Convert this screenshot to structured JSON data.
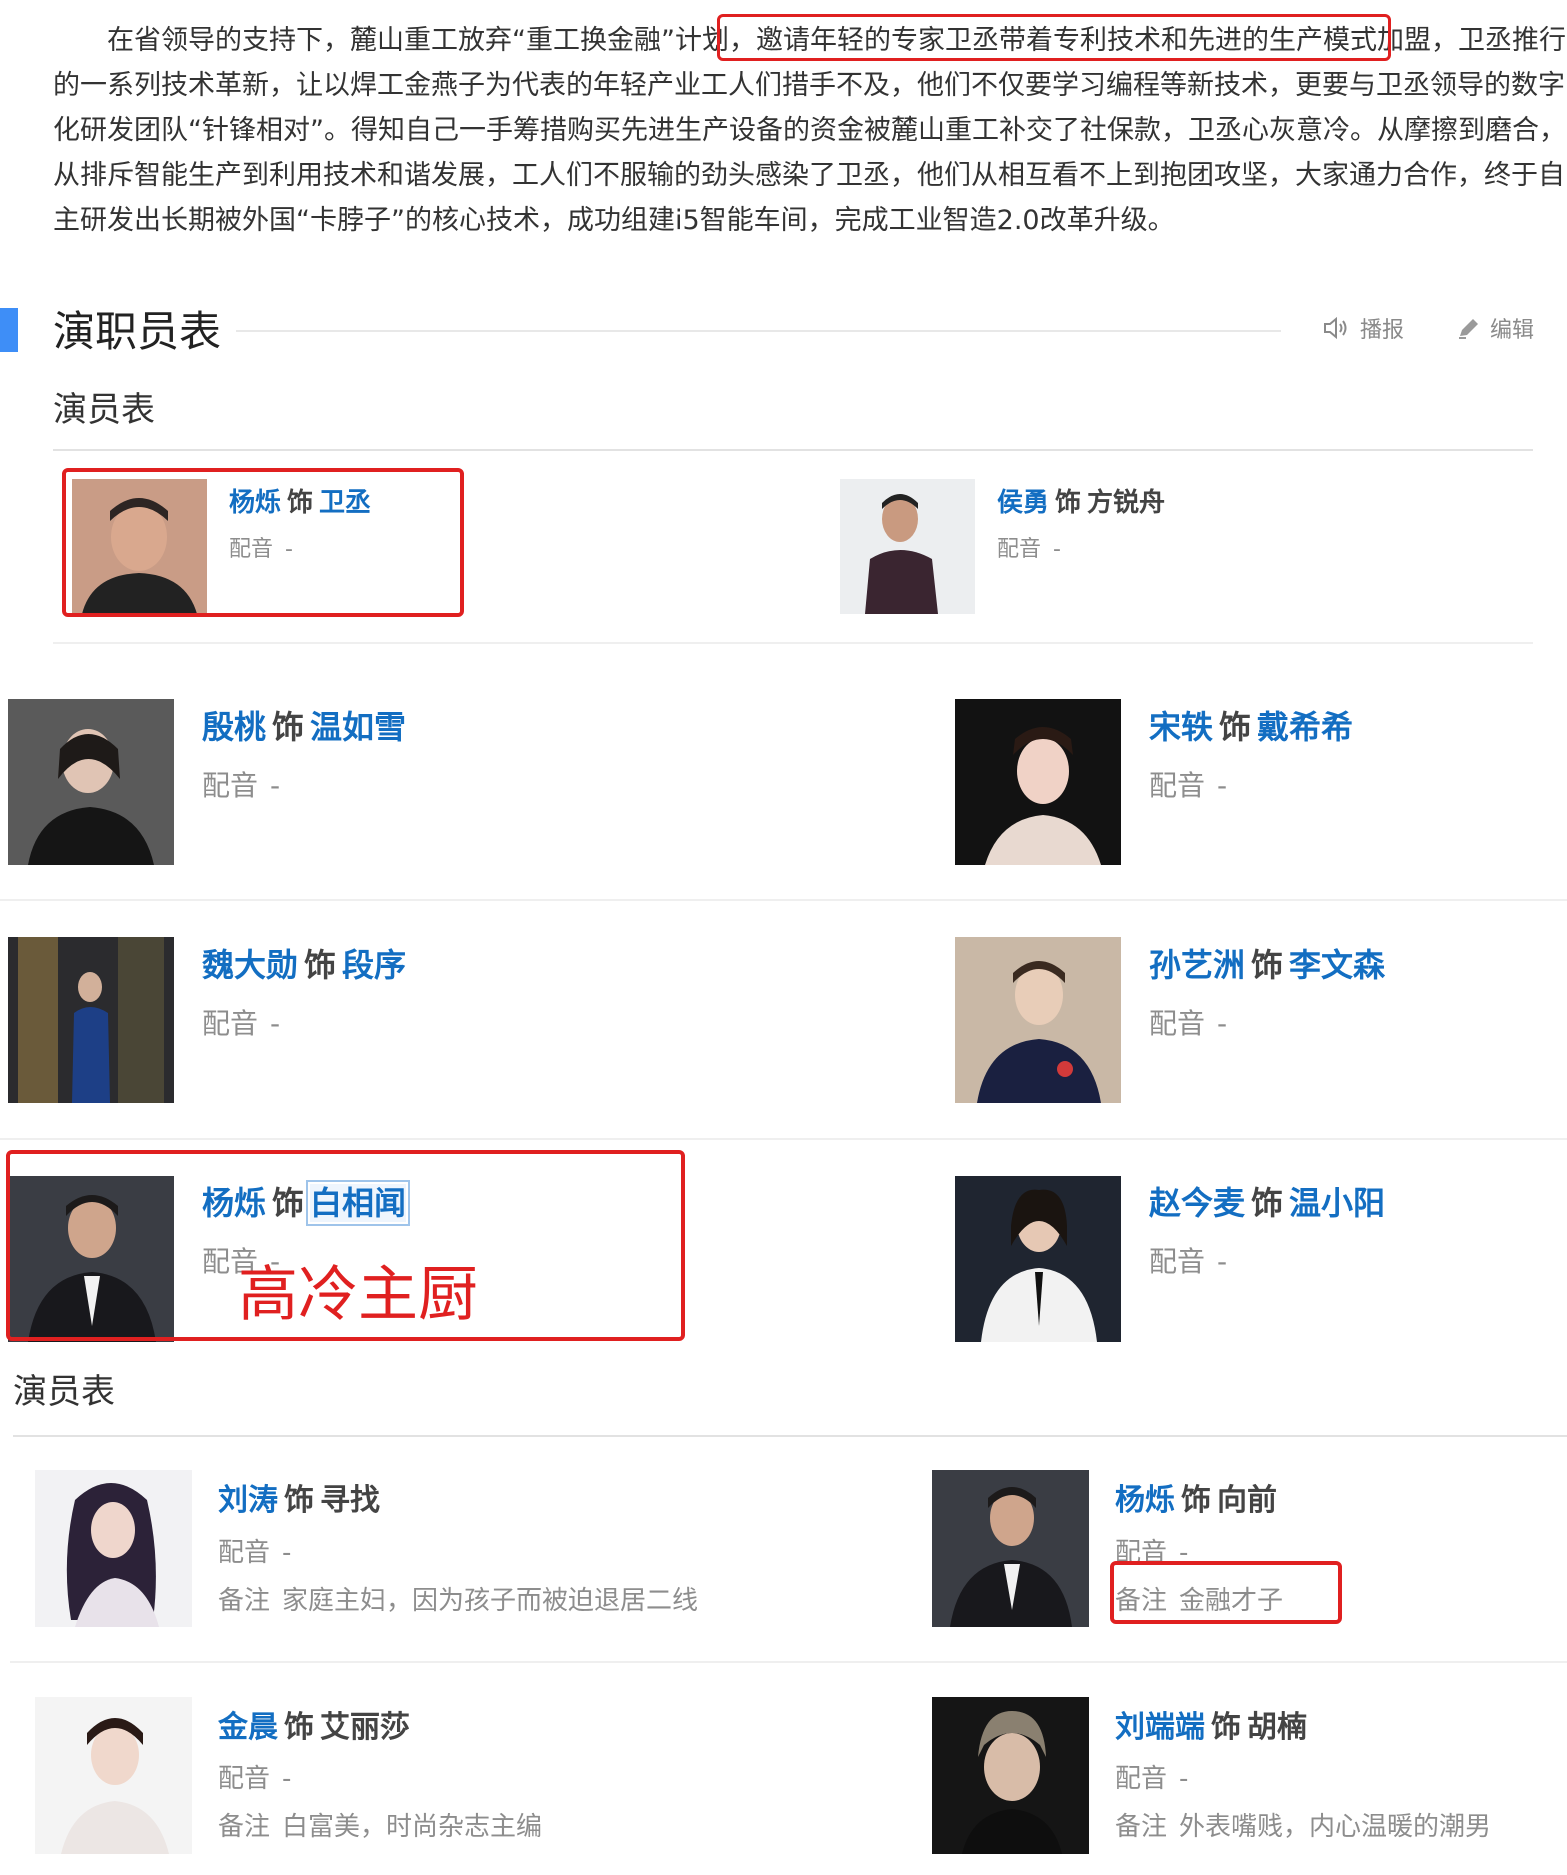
{
  "intro": {
    "lines": [
      "　　在省领导的支持下，麓山重工放弃“重工换金融”计划，邀请年轻的专家卫丞带着专利技术和先进的生产模式加盟，卫丞推行",
      "的一系列技术革新，让以焊工金燕子为代表的年轻产业工人们措手不及，他们不仅要学习编程等新技术，更要与卫丞领导的数字",
      "化研发团队“针锋相对”。得知自己一手筹措购买先进生产设备的资金被麓山重工补交了社保款，卫丞心灰意冷。从摩擦到磨合，",
      "从排斥智能生产到利用技术和谐发展，工人们不服输的劲头感染了卫丞，他们从相互看不上到抱团攻坚，大家通力合作，终于自",
      "主研发出长期被外国“卡脖子”的核心技术，成功组建i5智能车间，完成工业智造2.0改革升级。"
    ]
  },
  "section": {
    "title": "演职员表",
    "broadcast_label": "播报",
    "edit_label": "编辑",
    "broadcast_icon": "speaker-icon",
    "edit_icon": "pencil-icon"
  },
  "cast1": {
    "subtitle": "演员表",
    "members": [
      {
        "actor": "杨烁",
        "as": "饰",
        "role": "卫丞",
        "voice_label": "配音",
        "voice_value": "-"
      },
      {
        "actor": "侯勇",
        "as": "饰",
        "role": "方锐舟",
        "voice_label": "配音",
        "voice_value": "-"
      },
      {
        "actor": "殷桃",
        "as": "饰",
        "role": "温如雪",
        "voice_label": "配音",
        "voice_value": "-"
      },
      {
        "actor": "宋轶",
        "as": "饰",
        "role": "戴希希",
        "voice_label": "配音",
        "voice_value": "-"
      },
      {
        "actor": "魏大勋",
        "as": "饰",
        "role": "段序",
        "voice_label": "配音",
        "voice_value": "-"
      },
      {
        "actor": "孙艺洲",
        "as": "饰",
        "role": "李文森",
        "voice_label": "配音",
        "voice_value": "-"
      },
      {
        "actor": "杨烁",
        "as": "饰",
        "role": "白相闻",
        "voice_label": "配音",
        "voice_value": "-"
      },
      {
        "actor": "赵今麦",
        "as": "饰",
        "role": "温小阳",
        "voice_label": "配音",
        "voice_value": "-"
      }
    ],
    "annotation": "高冷主厨"
  },
  "cast2": {
    "subtitle": "演员表",
    "members": [
      {
        "actor": "刘涛",
        "as": "饰",
        "role": "寻找",
        "voice_label": "配音",
        "voice_value": "-",
        "note_label": "备注",
        "note_value": "家庭主妇，因为孩子而被迫退居二线"
      },
      {
        "actor": "杨烁",
        "as": "饰",
        "role": "向前",
        "voice_label": "配音",
        "voice_value": "-",
        "note_label": "备注",
        "note_value": "金融才子"
      },
      {
        "actor": "金晨",
        "as": "饰",
        "role": "艾丽莎",
        "voice_label": "配音",
        "voice_value": "-",
        "note_label": "备注",
        "note_value": "白富美，时尚杂志主编"
      },
      {
        "actor": "刘端端",
        "as": "饰",
        "role": "胡楠",
        "voice_label": "配音",
        "voice_value": "-",
        "note_label": "备注",
        "note_value": "外表嘴贱，内心温暖的潮男"
      }
    ]
  }
}
